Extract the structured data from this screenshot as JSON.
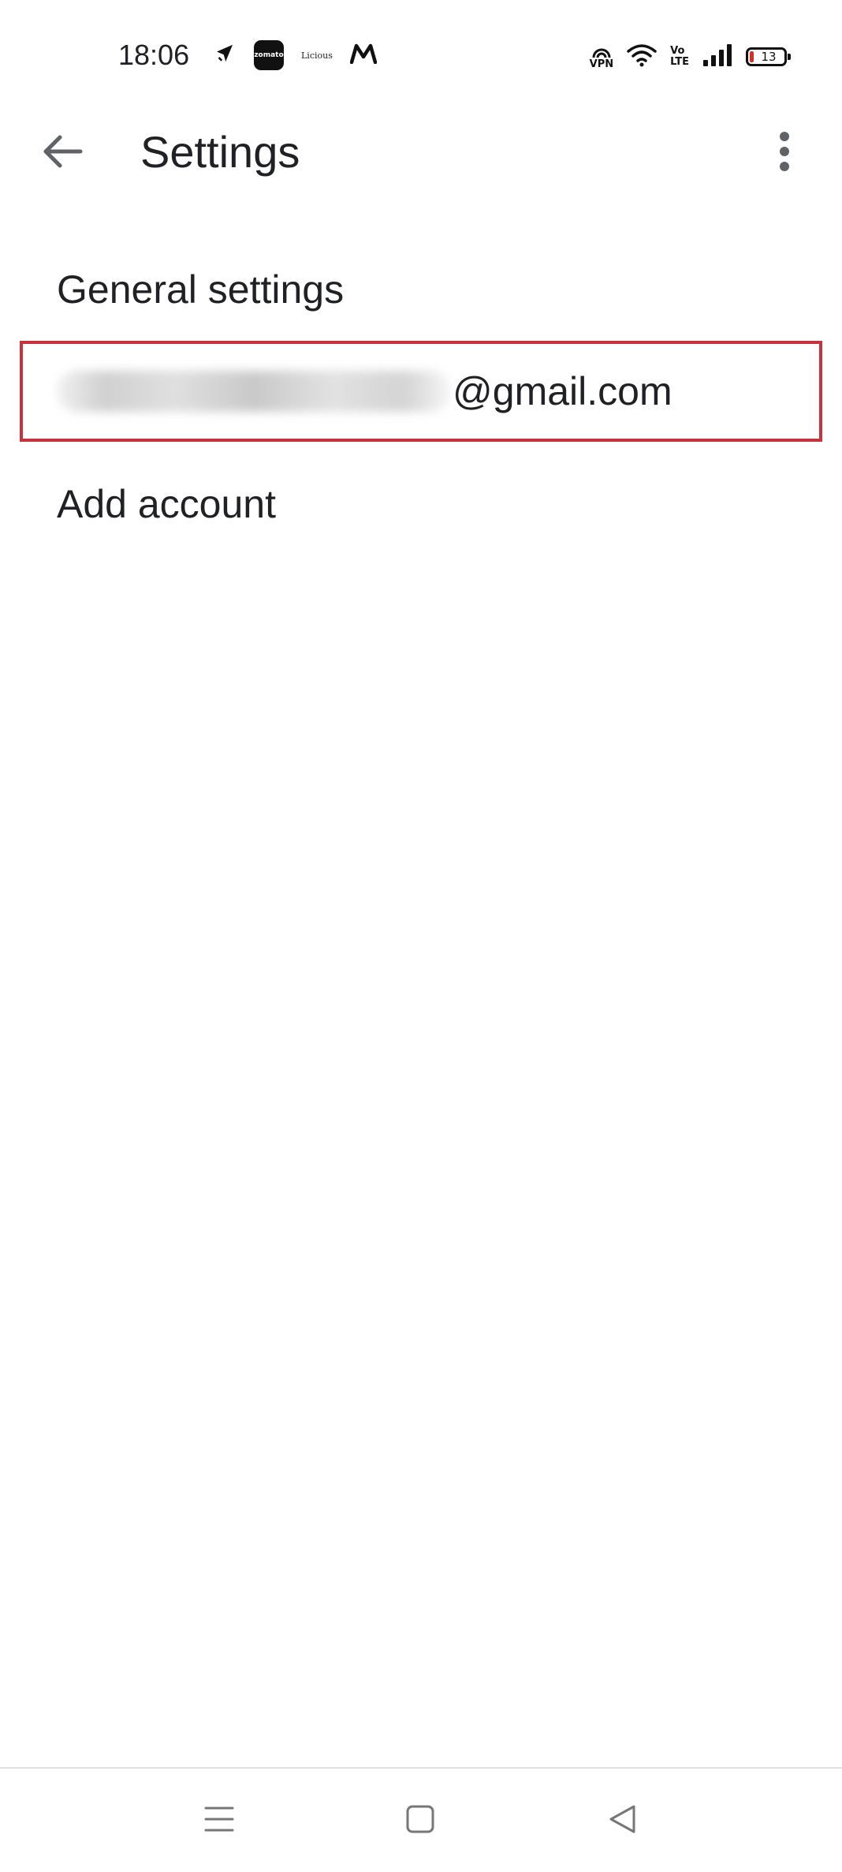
{
  "status_bar": {
    "time": "18:06",
    "app_icons": [
      "navigation-arrow-icon",
      "zomato-icon",
      "licious-icon",
      "myntra-icon"
    ],
    "zomato_label": "zomato",
    "licious_label": "Licious",
    "vpn_label": "VPN",
    "volte_top": "Vo",
    "volte_bottom": "LTE",
    "battery_level": "13",
    "battery_color": "#d93025"
  },
  "app_bar": {
    "title": "Settings",
    "back_icon": "arrow-back-icon",
    "menu_icon": "more-vert-icon"
  },
  "settings": {
    "general": "General settings",
    "account_domain": "@gmail.com",
    "add_account": "Add account"
  },
  "highlight": {
    "color": "#c8323c"
  },
  "nav_bar": {
    "buttons": [
      "menu-lines-icon",
      "home-square-icon",
      "back-triangle-icon"
    ]
  }
}
